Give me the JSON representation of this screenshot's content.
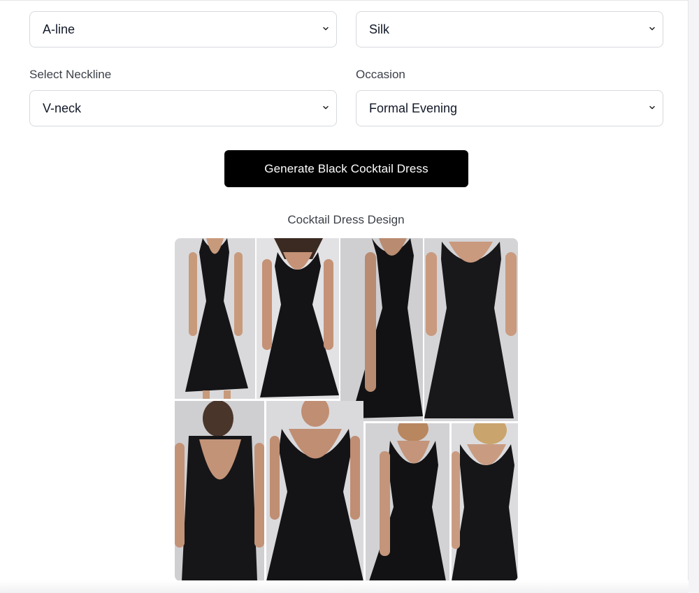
{
  "form": {
    "silhouette_value": "A-line",
    "fabric_value": "Silk",
    "neckline_label": "Select Neckline",
    "neckline_value": "V-neck",
    "occasion_label": "Occasion",
    "occasion_value": "Formal Evening"
  },
  "actions": {
    "generate_label": "Generate Black Cocktail Dress"
  },
  "result": {
    "caption": "Cocktail Dress Design",
    "image_subject": "collage of eight black sleeveless V-neck satin cocktail dresses on models"
  },
  "icons": {
    "select_indicator": "chevron-down-icon"
  },
  "colors": {
    "button_bg": "#000000",
    "button_text": "#ffffff",
    "border": "#d7d9de",
    "text": "#111827",
    "label_text": "#3b3f47"
  }
}
